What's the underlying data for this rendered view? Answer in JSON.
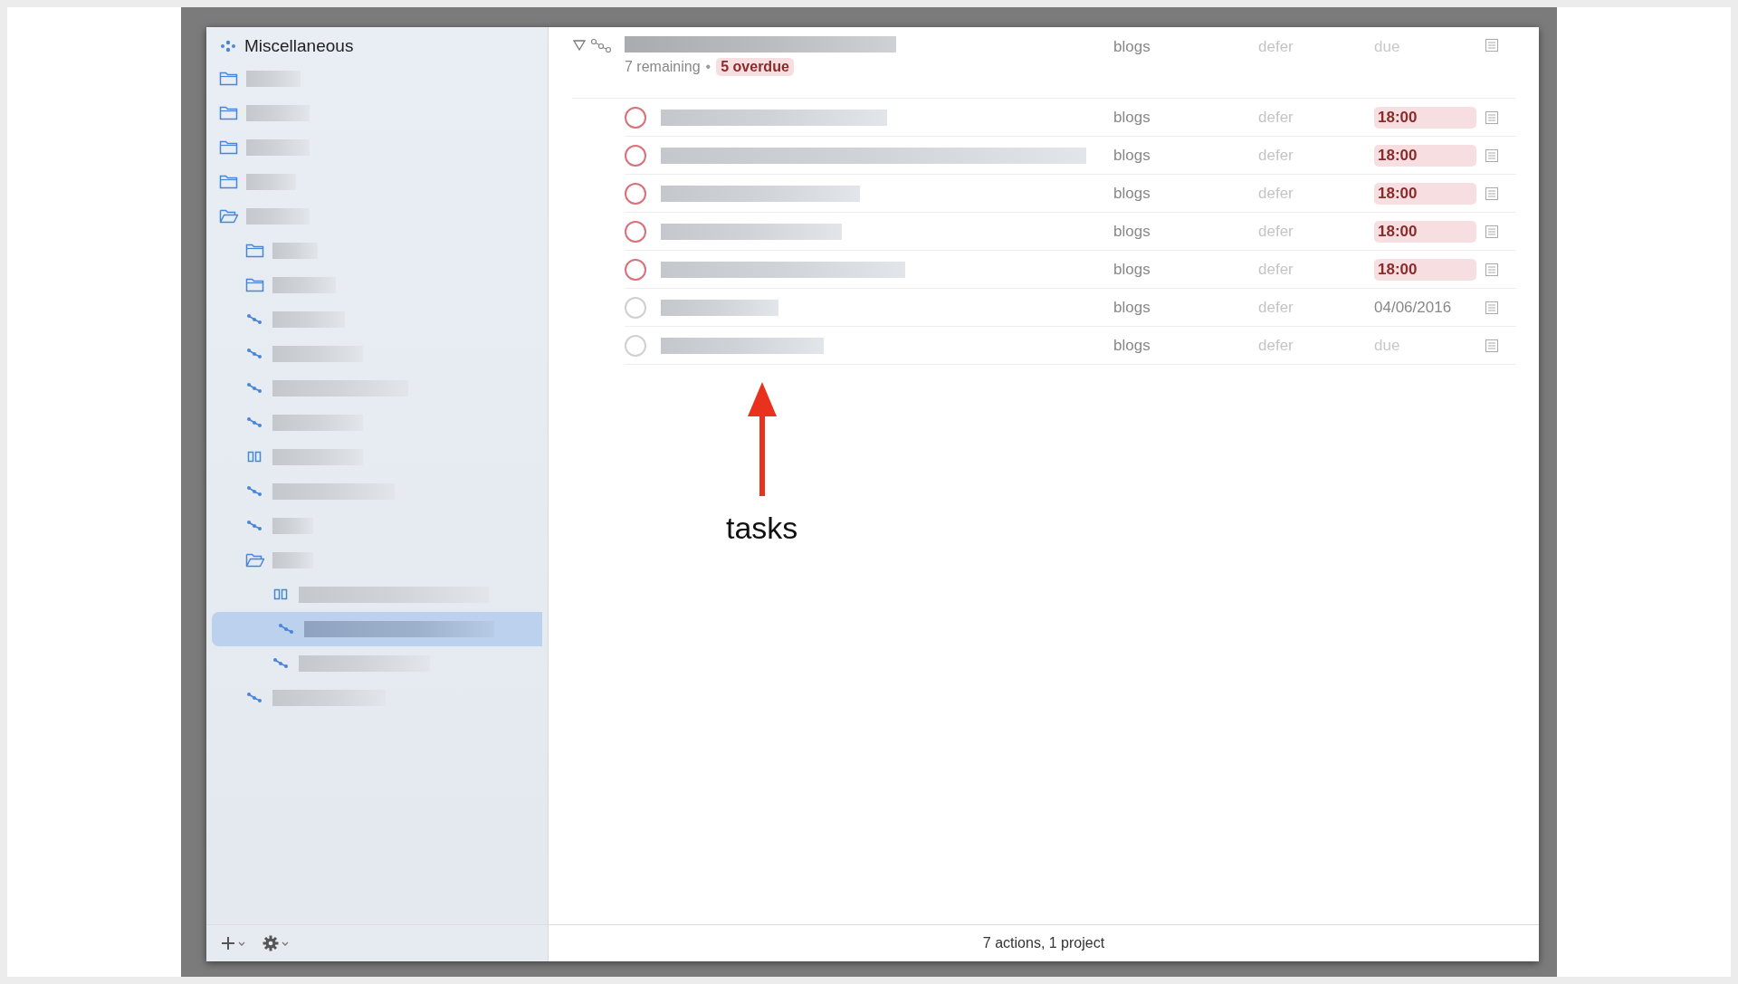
{
  "sidebar": {
    "header": {
      "label": "Miscellaneous"
    },
    "items": [
      {
        "kind": "folder",
        "expanded": false,
        "selected": false
      },
      {
        "kind": "folder",
        "expanded": false,
        "selected": false
      },
      {
        "kind": "folder",
        "expanded": false,
        "selected": false
      },
      {
        "kind": "folder",
        "expanded": false,
        "selected": false
      },
      {
        "kind": "folder",
        "expanded": true,
        "selected": false,
        "children": [
          {
            "kind": "folder",
            "expanded": false,
            "selected": false
          },
          {
            "kind": "folder",
            "expanded": false,
            "selected": false
          },
          {
            "kind": "project",
            "selected": false
          },
          {
            "kind": "project",
            "selected": false
          },
          {
            "kind": "project",
            "selected": false
          },
          {
            "kind": "project",
            "selected": false
          },
          {
            "kind": "parallel",
            "selected": false
          },
          {
            "kind": "project",
            "selected": false
          },
          {
            "kind": "project",
            "selected": false
          },
          {
            "kind": "folder",
            "expanded": true,
            "selected": false,
            "children": [
              {
                "kind": "parallel",
                "selected": false
              },
              {
                "kind": "project",
                "selected": true
              },
              {
                "kind": "project",
                "selected": false
              }
            ]
          },
          {
            "kind": "project",
            "selected": false
          }
        ]
      }
    ]
  },
  "project": {
    "expanded": true,
    "remaining": "7 remaining",
    "separator": "•",
    "overdue": "5 overdue",
    "context": "blogs",
    "defer": "defer",
    "due": "due"
  },
  "tasks": [
    {
      "checked": false,
      "overdue": true,
      "due_set": true,
      "context": "blogs",
      "defer": "defer",
      "due": "18:00"
    },
    {
      "checked": false,
      "overdue": true,
      "due_set": true,
      "context": "blogs",
      "defer": "defer",
      "due": "18:00"
    },
    {
      "checked": false,
      "overdue": true,
      "due_set": true,
      "context": "blogs",
      "defer": "defer",
      "due": "18:00"
    },
    {
      "checked": false,
      "overdue": true,
      "due_set": true,
      "context": "blogs",
      "defer": "defer",
      "due": "18:00"
    },
    {
      "checked": false,
      "overdue": true,
      "due_set": true,
      "context": "blogs",
      "defer": "defer",
      "due": "18:00"
    },
    {
      "checked": false,
      "overdue": false,
      "due_set": true,
      "context": "blogs",
      "defer": "defer",
      "due": "04/06/2016"
    },
    {
      "checked": false,
      "overdue": false,
      "due_set": false,
      "context": "blogs",
      "defer": "defer",
      "due": "due"
    }
  ],
  "status_bar": "7 actions, 1 project",
  "annotation": {
    "label": "tasks"
  }
}
